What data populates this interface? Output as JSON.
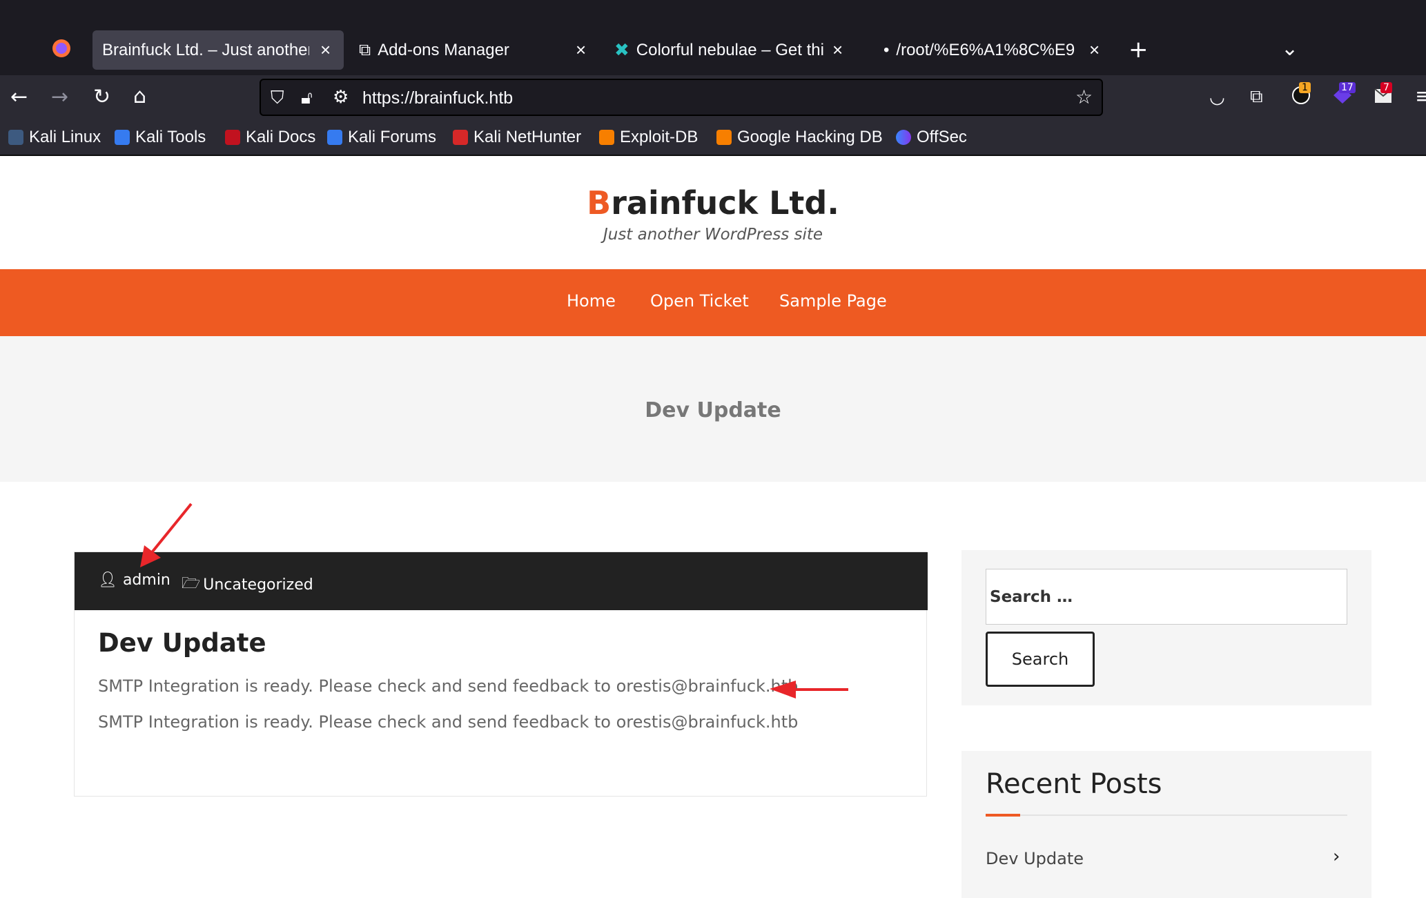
{
  "browser": {
    "tabs": [
      {
        "label": "Brainfuck Ltd. – Just another",
        "active": true
      },
      {
        "label": "Add-ons Manager",
        "active": false
      },
      {
        "label": "Colorful nebulae – Get thi",
        "active": false
      },
      {
        "label": "/root/%E6%A1%8C%E9",
        "active": false
      }
    ],
    "url": "https://brainfuck.htb",
    "bookmarks": [
      "Kali Linux",
      "Kali Tools",
      "Kali Docs",
      "Kali Forums",
      "Kali NetHunter",
      "Exploit-DB",
      "Google Hacking DB",
      "OffSec"
    ],
    "badges": {
      "ublock": "1",
      "ext2": "17",
      "ext3": "7"
    }
  },
  "site": {
    "title_first": "B",
    "title_rest": "rainfuck Ltd.",
    "tagline": "Just another WordPress site",
    "menu": [
      "Home",
      "Open Ticket",
      "Sample Page"
    ],
    "banner_title": "Dev Update"
  },
  "post": {
    "author": "admin",
    "category": "Uncategorized",
    "title": "Dev Update",
    "lines": [
      "SMTP Integration is ready. Please check and send feedback to orestis@brainfuck.htb",
      "SMTP Integration is ready. Please check and send feedback to orestis@brainfuck.htb"
    ]
  },
  "sidebar": {
    "search_placeholder": "Search …",
    "search_button": "Search",
    "recent_title": "Recent Posts",
    "recent_items": [
      "Dev Update"
    ]
  },
  "colors": {
    "accent": "#ee5a24",
    "annotation_arrow": "#e8262a"
  }
}
